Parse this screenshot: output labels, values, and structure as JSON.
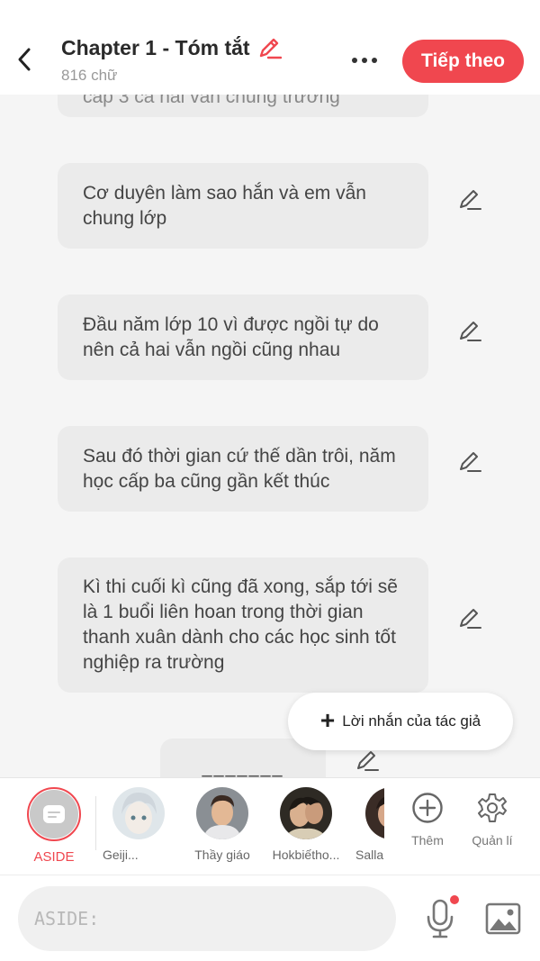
{
  "header": {
    "title": "Chapter 1 - Tóm tắt",
    "word_count": "816 chữ",
    "next_label": "Tiếp theo"
  },
  "messages": [
    {
      "text": "cấp 3 cả hai vẫn chung trường"
    },
    {
      "text": "Cơ duyên làm sao hắn và em vẫn chung lớp"
    },
    {
      "text": "Đầu năm lớp 10 vì được ngồi tự do nên cả hai vẫn ngồi cũng nhau"
    },
    {
      "text": "Sau đó thời gian cứ thế dần trôi, năm học cấp ba cũng gần kết thúc"
    },
    {
      "text": "Kì thi cuối kì cũng đã xong, sắp tới sẽ là 1 buổi liên hoan trong thời gian thanh xuân dành cho các học sinh tốt nghiệp ra trường"
    },
    {
      "text": "_______"
    }
  ],
  "author_note": {
    "plus": "+",
    "label": "Lời nhắn của tác giả"
  },
  "characters": {
    "selected_label": "ASIDE",
    "list": [
      {
        "name": "Geiji..."
      },
      {
        "name": "Thầy giáo"
      },
      {
        "name": "Hokbiếtho..."
      },
      {
        "name": "Salla"
      }
    ],
    "add_label": "Thêm",
    "manage_label": "Quản lí"
  },
  "composer": {
    "placeholder": "ASIDE:",
    "value": ""
  },
  "colors": {
    "accent": "#f0474f",
    "bubble": "#ebebeb",
    "background": "#f5f5f5"
  },
  "icons": {
    "back": "chevron-left-icon",
    "edit": "pencil-icon",
    "more": "more-dots-icon",
    "aside": "chat-bubble-icon",
    "add": "plus-circle-icon",
    "manage": "gear-icon",
    "mic": "microphone-icon",
    "image": "image-icon"
  }
}
